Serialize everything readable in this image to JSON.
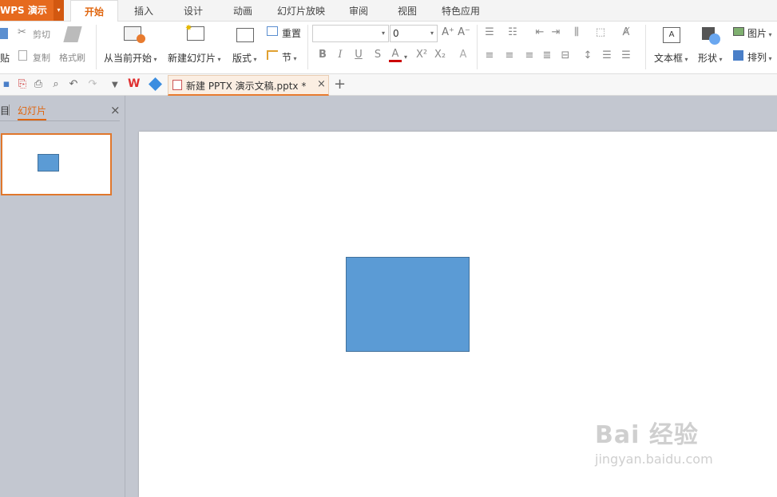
{
  "app": {
    "name": "WPS 演示",
    "menu_caret": "▾"
  },
  "menu_tabs": [
    "开始",
    "插入",
    "设计",
    "动画",
    "幻灯片放映",
    "审阅",
    "视图",
    "特色应用"
  ],
  "ribbon": {
    "clipboard": {
      "paste": "贴",
      "cut": "剪切",
      "copy": "复制",
      "format_painter": "格式刷"
    },
    "slides": {
      "from_current": "从当前开始",
      "new_slide": "新建幻灯片",
      "layout": "版式",
      "reset": "重置",
      "section": "节"
    },
    "font": {
      "name_value": "",
      "size_value": "0",
      "bold": "B",
      "italic": "I",
      "underline": "U",
      "shadow": "S",
      "color": "A",
      "superscript": "X²",
      "subscript": "X₂",
      "grow": "A⁺",
      "shrink": "A⁻",
      "clear": "A"
    },
    "insert": {
      "textbox": "文本框",
      "shape": "形状",
      "picture": "图片",
      "arrange": "排列"
    }
  },
  "quick_access": {
    "doc_tab": "新建 PPTX 演示文稿.pptx *",
    "close": "×",
    "add": "+"
  },
  "panel": {
    "outline_tab": "目",
    "slides_tab": "幻灯片",
    "close": "×"
  },
  "watermark": {
    "brand": "Bai 经验",
    "url": "jingyan.baidu.com"
  },
  "colors": {
    "accent": "#e66a1e",
    "shape_fill": "#5b9bd5",
    "shape_border": "#41719c"
  }
}
